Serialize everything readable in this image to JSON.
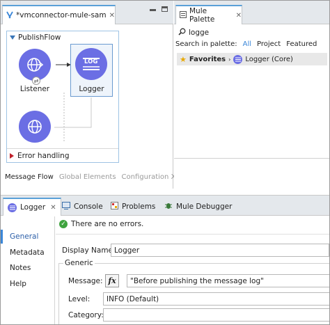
{
  "editor": {
    "tab_title": "*vmconnector-mule-sample",
    "flow_name": "PublishFlow",
    "components": [
      {
        "label": "Listener"
      },
      {
        "label": "Logger",
        "icon_text": "LOG"
      }
    ],
    "error_handling": "Error handling",
    "bottom_tabs": [
      "Message Flow",
      "Global Elements",
      "Configuration XML"
    ]
  },
  "palette": {
    "tab_title": "Mule Palette",
    "search_value": "logge",
    "search_in_label": "Search in palette:",
    "filters": [
      "All",
      "Project",
      "Featured"
    ],
    "favorites_label": "Favorites",
    "result": "Logger (Core)"
  },
  "bottom": {
    "tabs": [
      "Logger",
      "Console",
      "Problems",
      "Mule Debugger"
    ],
    "nav": [
      "General",
      "Metadata",
      "Notes",
      "Help"
    ],
    "status": "There are no errors.",
    "display_name_label": "Display Name:",
    "display_name_value": "Logger",
    "group_title": "Generic",
    "message_label": "Message:",
    "message_value": "\"Before publishing the message log\"",
    "level_label": "Level:",
    "level_value": "INFO (Default)",
    "category_label": "Category:",
    "category_value": "",
    "fx_label": "fx"
  },
  "colors": {
    "accent": "#3a86d8",
    "component": "#6b6ee4",
    "error": "#c0202a",
    "ok": "#3fa33f"
  }
}
